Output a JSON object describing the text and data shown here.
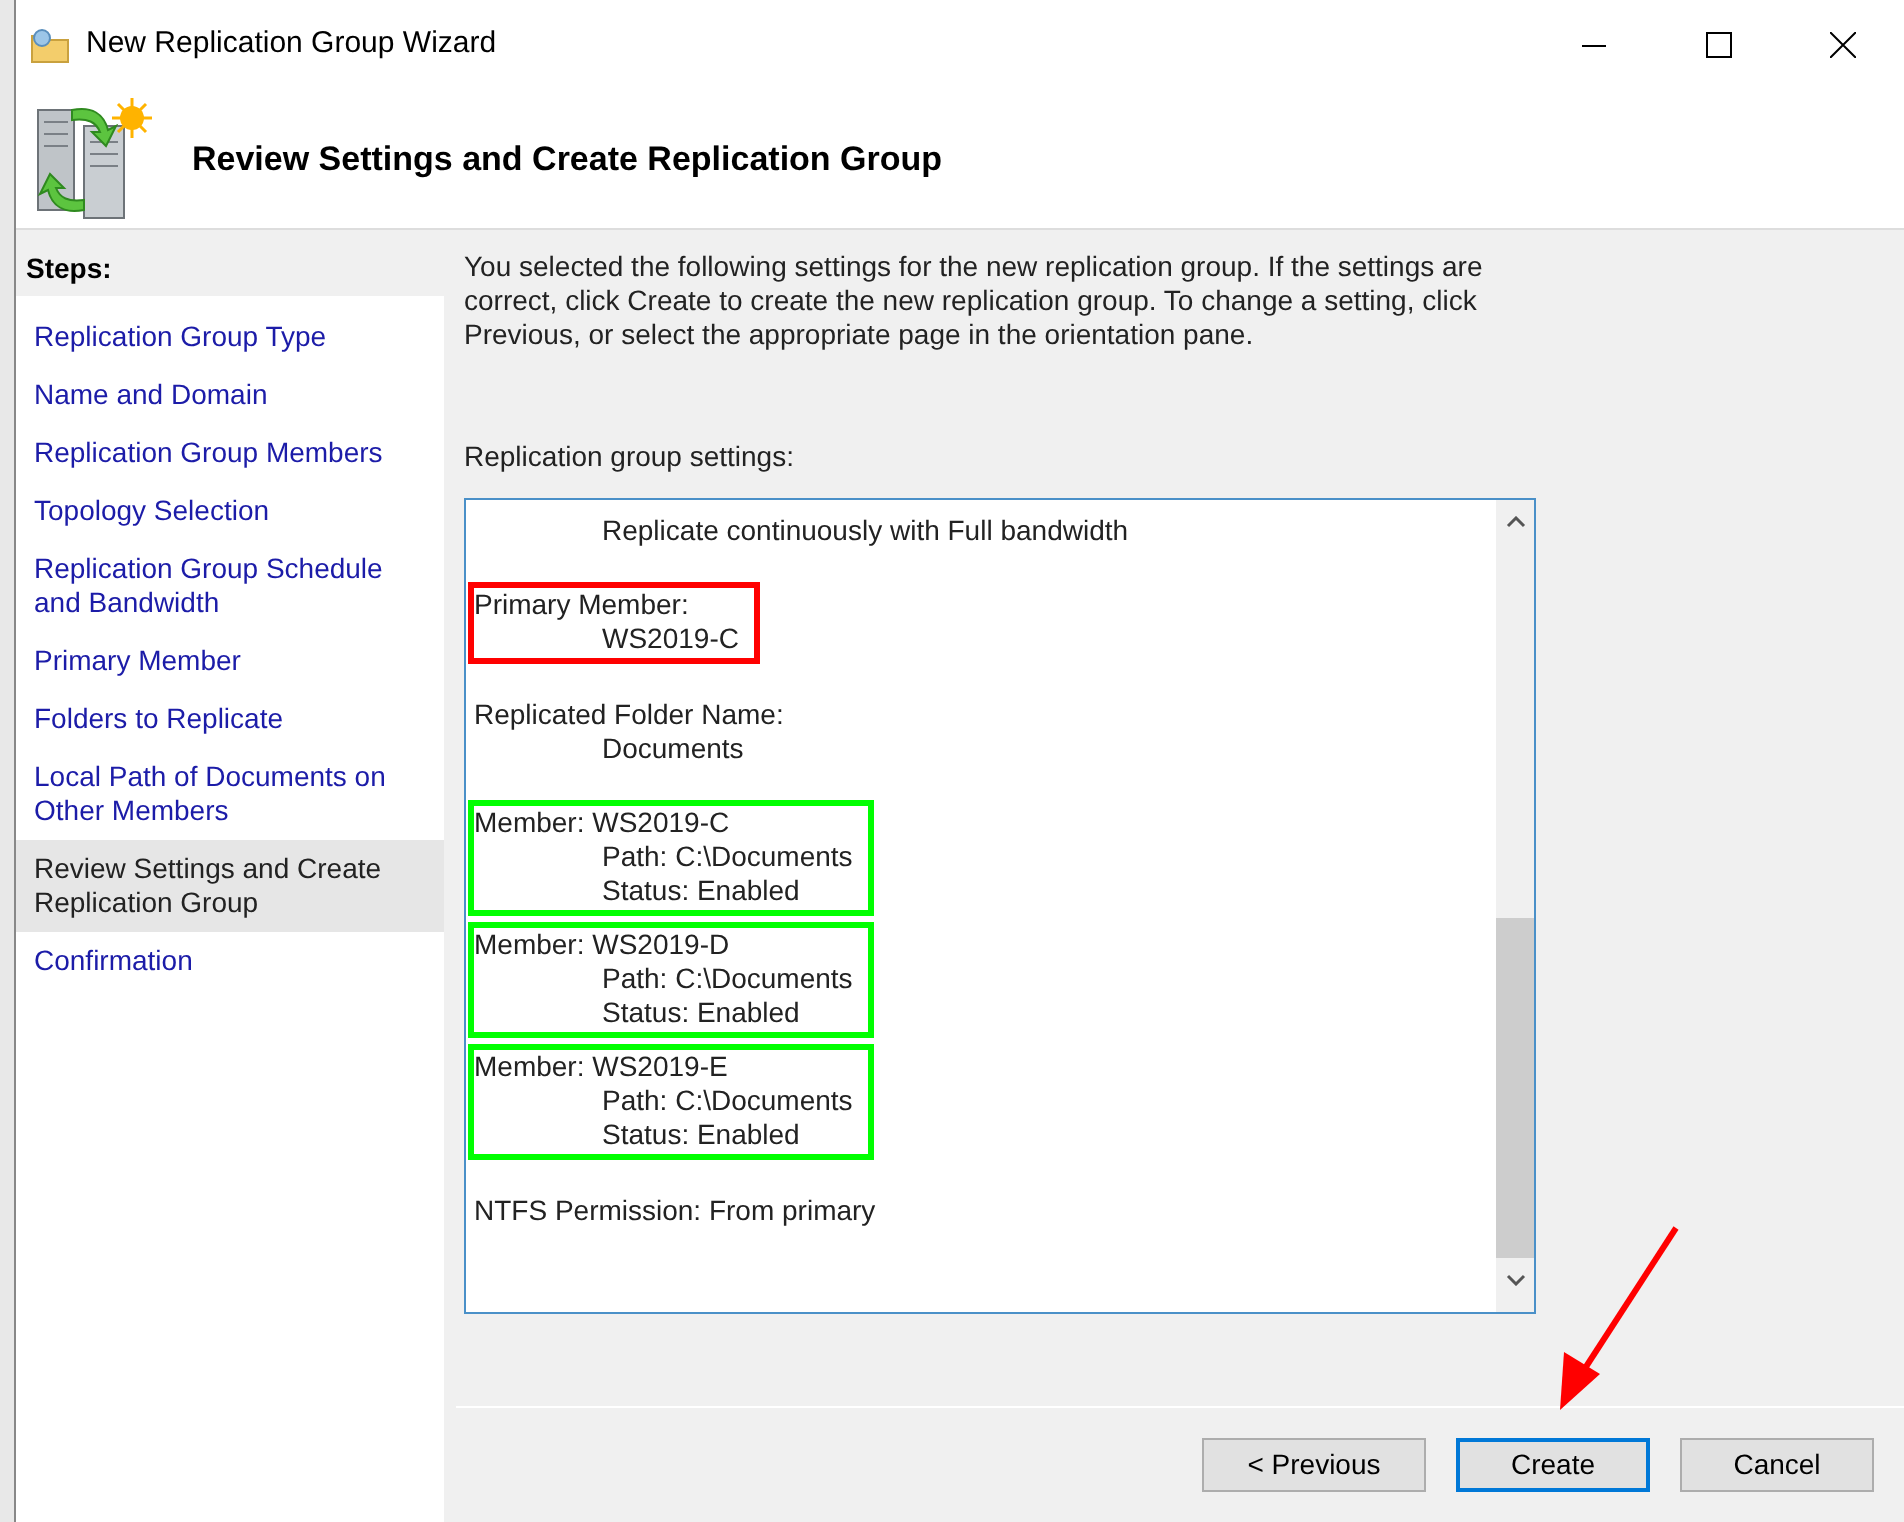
{
  "window": {
    "title": "New Replication Group Wizard"
  },
  "header": {
    "title": "Review Settings and Create Replication Group"
  },
  "steps": {
    "heading": "Steps:",
    "items": [
      {
        "label": "Replication Group Type",
        "selected": false
      },
      {
        "label": "Name and Domain",
        "selected": false
      },
      {
        "label": "Replication Group Members",
        "selected": false
      },
      {
        "label": "Topology Selection",
        "selected": false
      },
      {
        "label": "Replication Group Schedule and Bandwidth",
        "selected": false
      },
      {
        "label": "Primary Member",
        "selected": false
      },
      {
        "label": "Folders to Replicate",
        "selected": false
      },
      {
        "label": "Local Path of Documents on Other Members",
        "selected": false
      },
      {
        "label": "Review Settings and Create Replication Group",
        "selected": true
      },
      {
        "label": "Confirmation",
        "selected": false
      }
    ]
  },
  "intro": "You selected the following settings for the new replication group. If the settings are correct, click Create to create the new replication group. To change a setting, click Previous, or select the appropriate page in the orientation pane.",
  "settings_label": "Replication group settings:",
  "settings": [
    {
      "lines": [
        "Replicate continuously with Full bandwidth"
      ]
    },
    {
      "heading": "Primary Member:",
      "lines": [
        "WS2019-C"
      ],
      "color": "#ff0000"
    },
    {
      "heading": "Replicated Folder Name:",
      "lines": [
        "Documents"
      ]
    },
    {
      "heading": "Member: WS2019-C",
      "lines": [
        "Path: C:\\Documents",
        "Status: Enabled"
      ],
      "color": "#00ff00"
    },
    {
      "heading": "Member: WS2019-D",
      "lines": [
        "Path: C:\\Documents",
        "Status: Enabled"
      ],
      "color": "#00ff00"
    },
    {
      "heading": "Member: WS2019-E",
      "lines": [
        "Path: C:\\Documents",
        "Status: Enabled"
      ],
      "color": "#00ff00"
    },
    {
      "heading": "NTFS Permission: From primary"
    }
  ],
  "buttons": [
    {
      "label": "< Previous",
      "default": false
    },
    {
      "label": "Create",
      "default": true
    },
    {
      "label": "Cancel",
      "default": false
    }
  ],
  "pointer_arrow": true
}
